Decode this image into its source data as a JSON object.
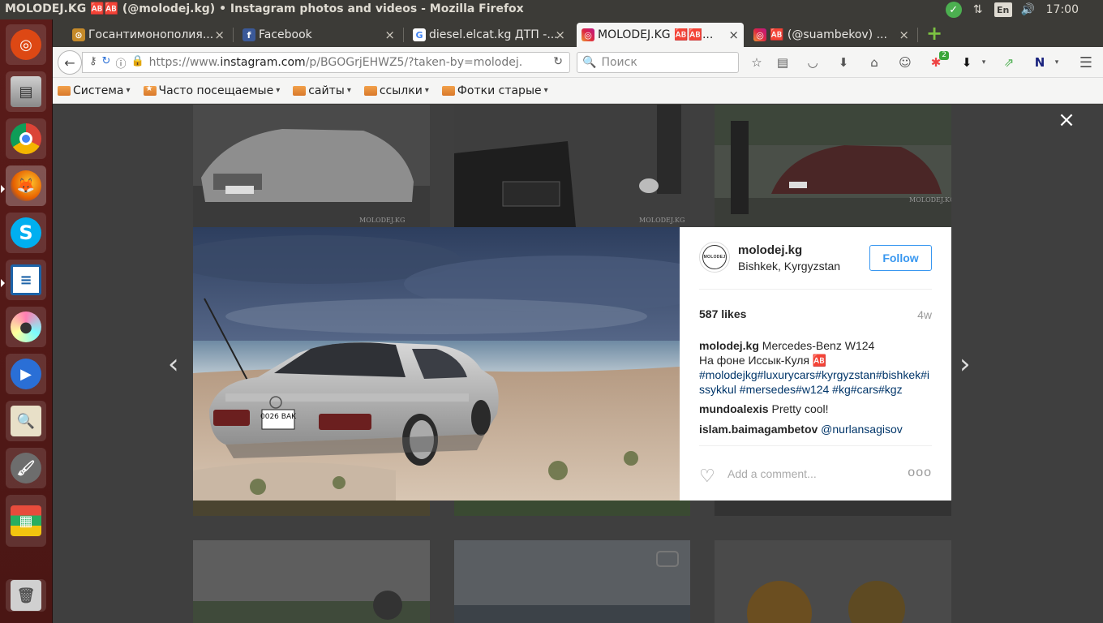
{
  "window": {
    "title": "MOLODEJ.KG 🆎🆎 (@molodej.kg) • Instagram photos and videos - Mozilla Firefox"
  },
  "tray": {
    "lang": "En",
    "time": "17:00"
  },
  "tabs": [
    {
      "label": "Госантимонополия...",
      "icon_bg": "#c58a2a",
      "icon": "⊙"
    },
    {
      "label": "Facebook",
      "icon_bg": "#3b5998",
      "icon": "f"
    },
    {
      "label": "diesel.elcat.kg ДТП -...",
      "icon_bg": "#ffffff",
      "icon": "G"
    },
    {
      "label": "MOLODEJ.KG 🆎🆎...",
      "icon_bg": "#c13584",
      "icon": "◎",
      "active": true
    },
    {
      "label": "🆎 (@suambekov) ...",
      "icon_bg": "#c13584",
      "icon": "◎"
    }
  ],
  "nav": {
    "url_prefix": "https://www.",
    "url_domain": "instagram.com",
    "url_rest": "/p/BGOGrjEHWZ5/?taken-by=molodej.",
    "search_placeholder": "Поиск",
    "badge_count": "2"
  },
  "bookmarks": [
    {
      "label": "Система",
      "star": false
    },
    {
      "label": "Часто посещаемые",
      "star": true
    },
    {
      "label": "сайты",
      "star": false
    },
    {
      "label": "ссылки",
      "star": false
    },
    {
      "label": "Фотки старые",
      "star": false
    }
  ],
  "post": {
    "username": "molodej.kg",
    "location": "Bishkek, Kyrgyzstan",
    "follow_label": "Follow",
    "likes": "587 likes",
    "age": "4w",
    "caption_user": "molodej.kg",
    "caption_text": "Mercedes-Benz W124",
    "caption_line2": "На фоне Иссык-Куля 🆎",
    "caption_tags": "#molodejkg#luxurycars#kyrgyzstan#bishkek#issykkul #mersedes#w124 #kg#cars#kgz",
    "avatar_text": "MOLODEJ",
    "plate_text": "0026 BAK",
    "comments": [
      {
        "user": "mundoalexis",
        "text": "Pretty cool!"
      },
      {
        "user": "islam.baimagambetov",
        "text": "@nurlansagisov"
      }
    ],
    "add_comment_placeholder": "Add a comment...",
    "more_label": "ooo"
  },
  "watermark": "MOLODEJ.KG"
}
